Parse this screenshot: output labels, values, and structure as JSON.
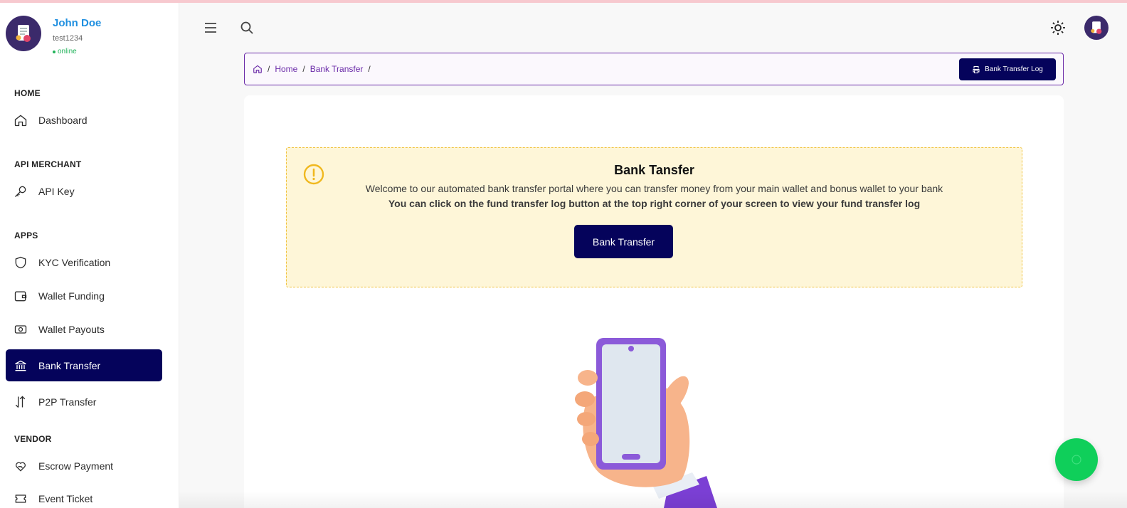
{
  "profile": {
    "name": "John Doe",
    "username": "test1234",
    "status": "online"
  },
  "sidebar": {
    "sections": {
      "home": "HOME",
      "api_merchant": "API MERCHANT",
      "apps": "APPS",
      "vendor": "VENDOR"
    },
    "items": [
      {
        "label": "Dashboard",
        "icon": "home-icon"
      },
      {
        "label": "API Key",
        "icon": "key-icon"
      },
      {
        "label": "KYC Verification",
        "icon": "shield-icon"
      },
      {
        "label": "Wallet Funding",
        "icon": "wallet-icon"
      },
      {
        "label": "Wallet Payouts",
        "icon": "cash-icon"
      },
      {
        "label": "Bank Transfer",
        "icon": "bank-icon",
        "active": true
      },
      {
        "label": "P2P Transfer",
        "icon": "transfer-arrows-icon"
      },
      {
        "label": "Escrow Payment",
        "icon": "heart-hand-icon"
      },
      {
        "label": "Event Ticket",
        "icon": "ticket-icon"
      }
    ]
  },
  "breadcrumb": {
    "items": [
      "Home",
      "Bank Transfer"
    ],
    "separator": "/",
    "log_button_label": "Bank Transfer Log"
  },
  "alert": {
    "title": "Bank Tansfer",
    "line1": "Welcome to our automated bank transfer portal where you can transfer money from your main wallet and bonus wallet to your bank",
    "line2": "You can click on the fund transfer log button at the top right corner of your screen to view your fund transfer log",
    "button_label": "Bank Transfer"
  },
  "colors": {
    "primary": "#05035b",
    "accent": "#6a2aa8",
    "alert_bg": "#fef6d8",
    "alert_border": "#f0c23b",
    "online": "#21b35a",
    "fab": "#0fcf5a"
  }
}
